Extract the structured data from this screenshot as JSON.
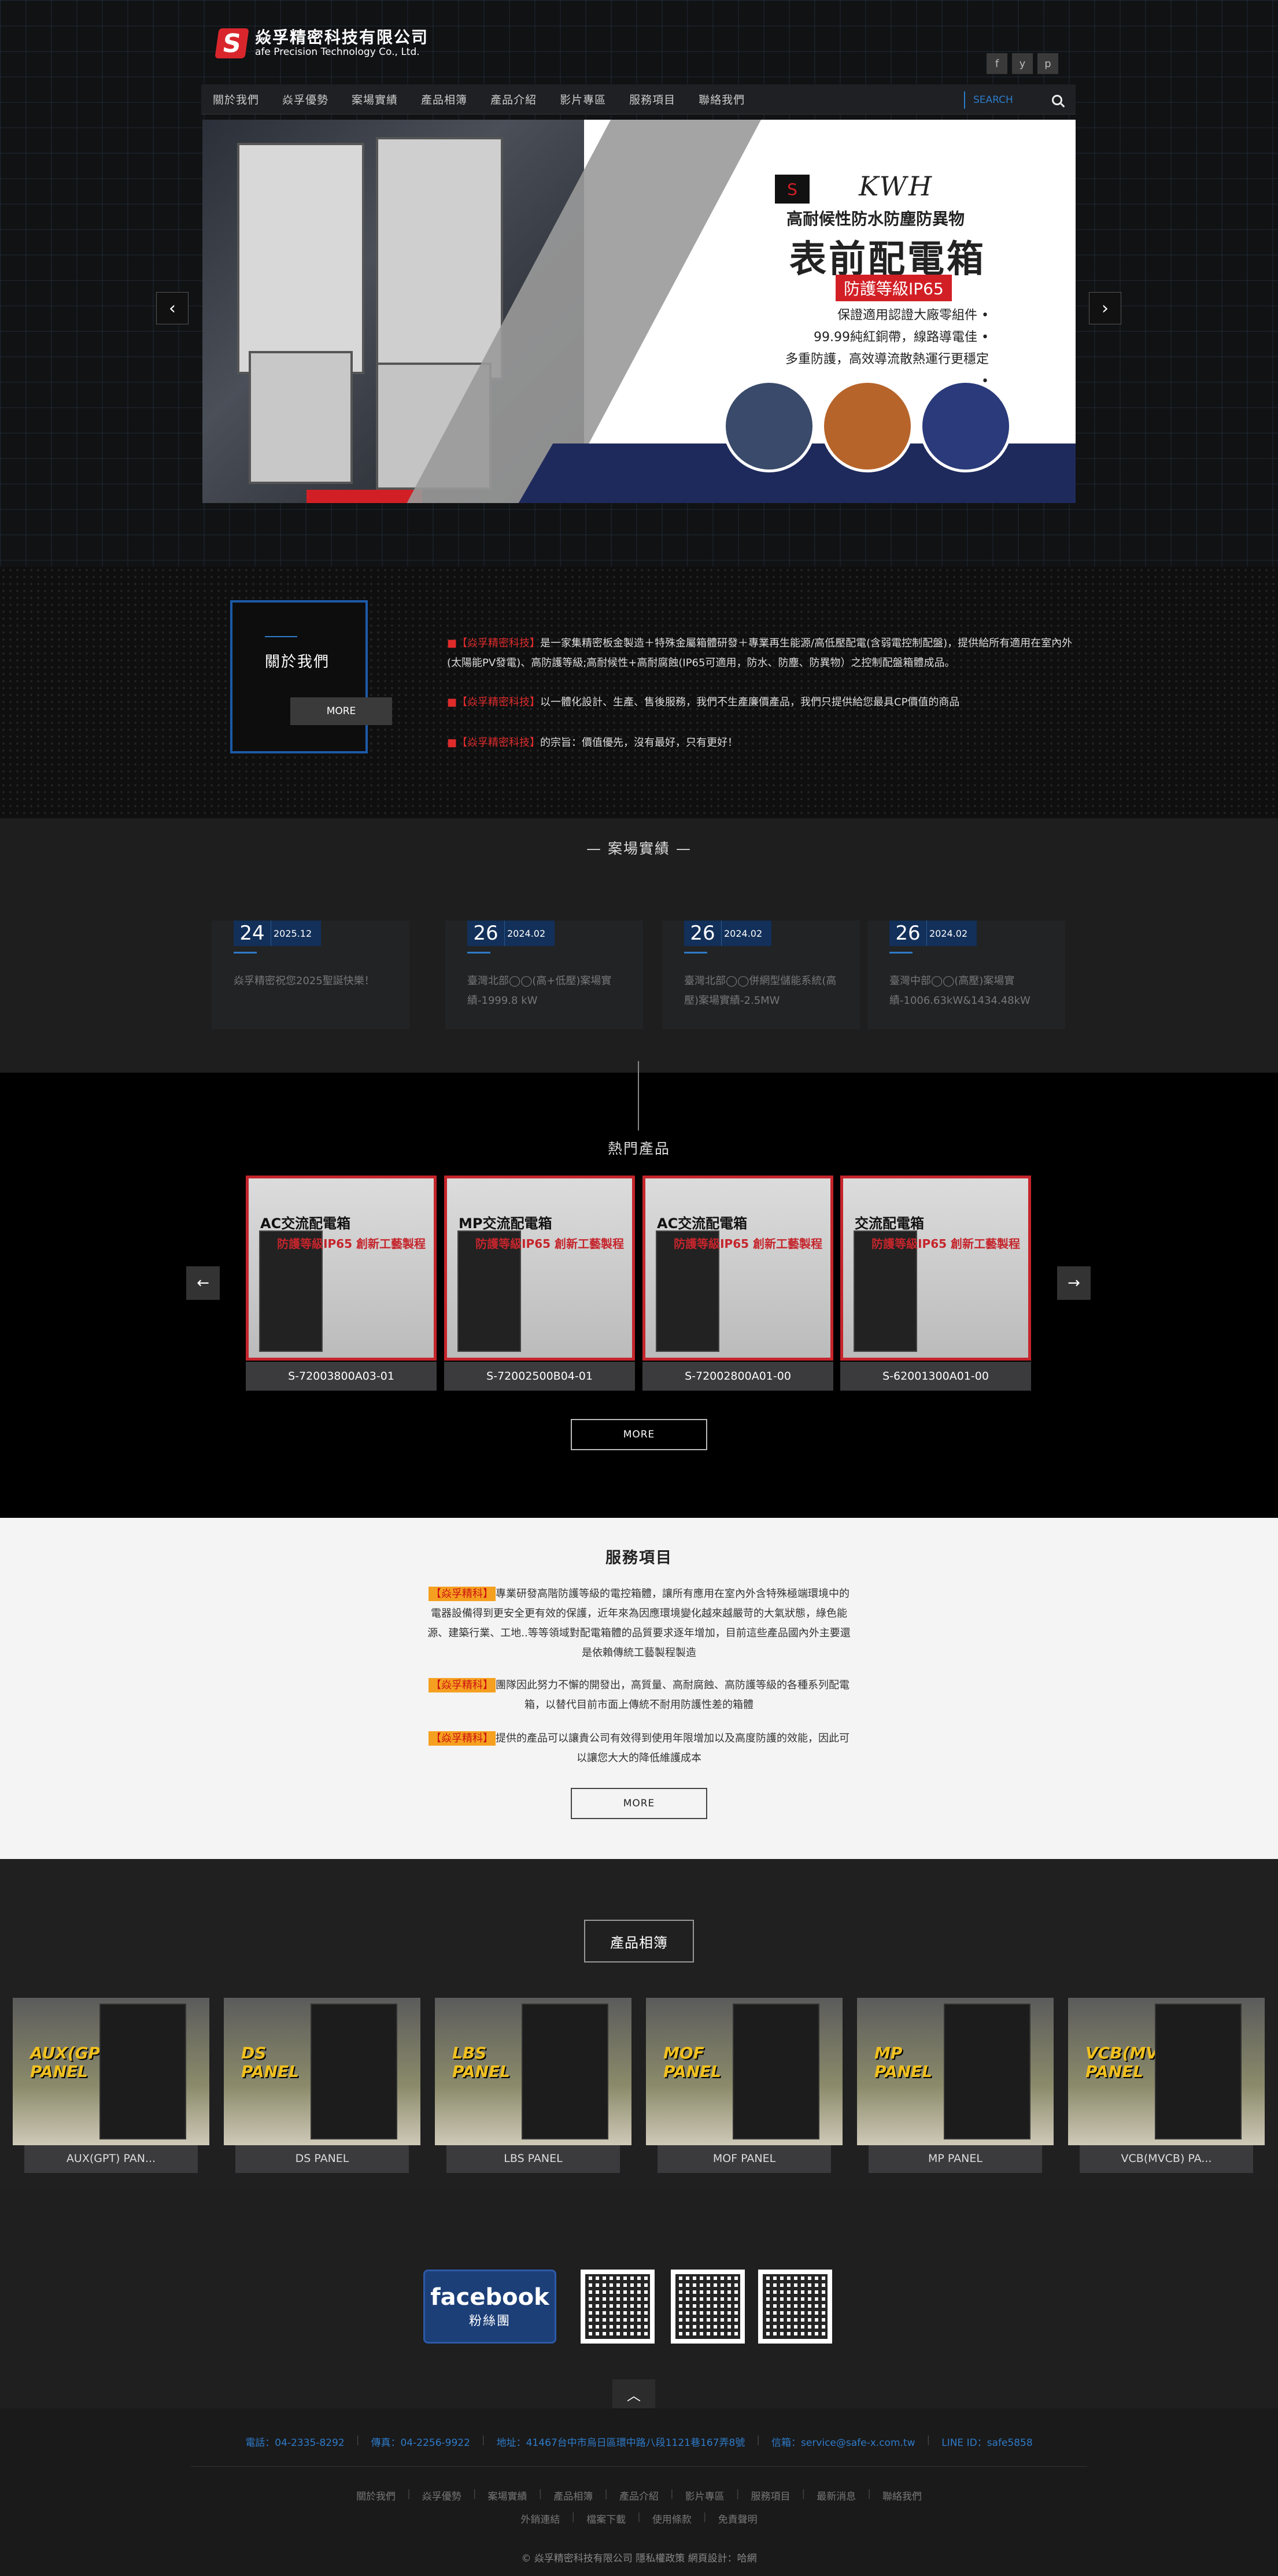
{
  "company": {
    "name_cn": "焱孚精密科技有限公司",
    "name_en": "afe Precision Technology Co., Ltd.",
    "logo_letter": "S"
  },
  "social": [
    "f",
    "y",
    "p"
  ],
  "nav": [
    "關於我們",
    "焱孚優勢",
    "案場實績",
    "產品相簿",
    "產品介紹",
    "影片專區",
    "服務項目",
    "聯絡我們"
  ],
  "search": {
    "placeholder": "SEARCH"
  },
  "banner": {
    "brand": "KWH",
    "subtitle": "高耐候性防水防塵防異物",
    "title": "表前配電箱",
    "badge": "防護等級IP65",
    "bullets": [
      "保證適用認證大廠零組件 •",
      "99.99純紅銅帶，線路導電佳 •",
      "多重防護，高效導流散熱運行更穩定 •"
    ]
  },
  "about": {
    "heading": "關於我們",
    "more": "MORE",
    "paragraphs": [
      {
        "brand": "【焱孚精密科技】",
        "text": "是一家集精密板金製造＋特殊金屬箱體研發＋專業再生能源/高低壓配電(含弱電控制配盤)，提供給所有適用在室內外(太陽能PV發電)、高防護等級;高耐候性+高耐腐蝕(IP65可適用，防水、防塵、防異物）之控制配盤箱體成品。"
      },
      {
        "brand": "【焱孚精密科技】",
        "text": "以一體化設計、生產、售後服務，我們不生產廉價產品，我們只提供給您最具CP價值的商品"
      },
      {
        "brand": "【焱孚精密科技】",
        "text": "的宗旨：價值優先，沒有最好，只有更好！"
      }
    ]
  },
  "cases": {
    "title": "案場實績",
    "items": [
      {
        "day": "24",
        "ym": "2025.12",
        "text": "焱孚精密祝您2025聖誕快樂！"
      },
      {
        "day": "26",
        "ym": "2024.02",
        "text": "臺灣北部◯◯(高+低壓)案場實績-1999.8 kW"
      },
      {
        "day": "26",
        "ym": "2024.02",
        "text": "臺灣北部◯◯併網型儲能系統(高壓)案場實績-2.5MW"
      },
      {
        "day": "26",
        "ym": "2024.02",
        "text": "臺灣中部◯◯(高壓)案場實績-1006.63kW&1434.48kW"
      }
    ]
  },
  "hot": {
    "title": "熱門產品",
    "more": "MORE",
    "items": [
      {
        "code": "S-72003800A03-01",
        "ttl": "AC交流配電箱",
        "sub": "防護等級IP65 創新工藝製程"
      },
      {
        "code": "S-72002500B04-01",
        "ttl": "MP交流配電箱",
        "sub": "防護等級IP65 創新工藝製程"
      },
      {
        "code": "S-72002800A01-00",
        "ttl": "AC交流配電箱",
        "sub": "防護等級IP65 創新工藝製程"
      },
      {
        "code": "S-62001300A01-00",
        "ttl": "交流配電箱",
        "sub": "防護等級IP65 創新工藝製程"
      }
    ]
  },
  "services": {
    "title": "服務項目",
    "more": "MORE",
    "paragraphs": [
      {
        "brand": "【焱孚精科】",
        "text": "專業研發高階防護等級的電控箱體，讓所有應用在室內外含特殊極端環境中的電器設備得到更安全更有效的保護，近年來為因應環境變化越來越嚴苛的大氣狀態，綠色能源、建築行業、工地..等等領域對配電箱體的品質要求逐年增加，目前這些產品國內外主要還是依賴傳統工藝製程製造"
      },
      {
        "brand": "【焱孚精科】",
        "text": "團隊因此努力不懈的開發出，高質量、高耐腐蝕、高防護等級的各種系列配電箱，以替代目前市面上傳統不耐用防護性差的箱體"
      },
      {
        "brand": "【焱孚精科】",
        "text": "提供的產品可以讓貴公司有效得到使用年限增加以及高度防護的效能，因此可以讓您大大的降低維護成本"
      }
    ]
  },
  "albums": {
    "title": "產品相簿",
    "items": [
      {
        "label": "AUX(GPT) PAN...",
        "img_text": "AUX(GPT) PANEL"
      },
      {
        "label": "DS PANEL",
        "img_text": "DS PANEL"
      },
      {
        "label": "LBS PANEL",
        "img_text": "LBS PANEL"
      },
      {
        "label": "MOF PANEL",
        "img_text": "MOF PANEL"
      },
      {
        "label": "MP PANEL",
        "img_text": "MP PANEL"
      },
      {
        "label": "VCB(MVCB) PA...",
        "img_text": "VCB(MVCB) PANEL"
      }
    ]
  },
  "facebook": {
    "word": "facebook",
    "sub": "粉絲團"
  },
  "footer": {
    "contact": [
      "電話：04-2335-8292",
      "傳真：04-2256-9922",
      "地址：41467台中市烏日區環中路八段1121巷167弄8號",
      "信箱：service@safe-x.com.tw",
      "LINE ID：safe5858"
    ],
    "links1": [
      "關於我們",
      "焱孚優勢",
      "案場實績",
      "產品相簿",
      "產品介紹",
      "影片專區",
      "服務項目",
      "最新消息",
      "聯絡我們"
    ],
    "links2": [
      "外銷連結",
      "檔案下載",
      "使用條款",
      "免責聲明"
    ],
    "copyright": "© 焱孚精密科技有限公司 隱私權政策  網頁設計：哈網"
  },
  "colors": {
    "accent_blue": "#2e7bc8",
    "brand_red": "#d9262d",
    "highlight_orange": "#f5a020"
  }
}
